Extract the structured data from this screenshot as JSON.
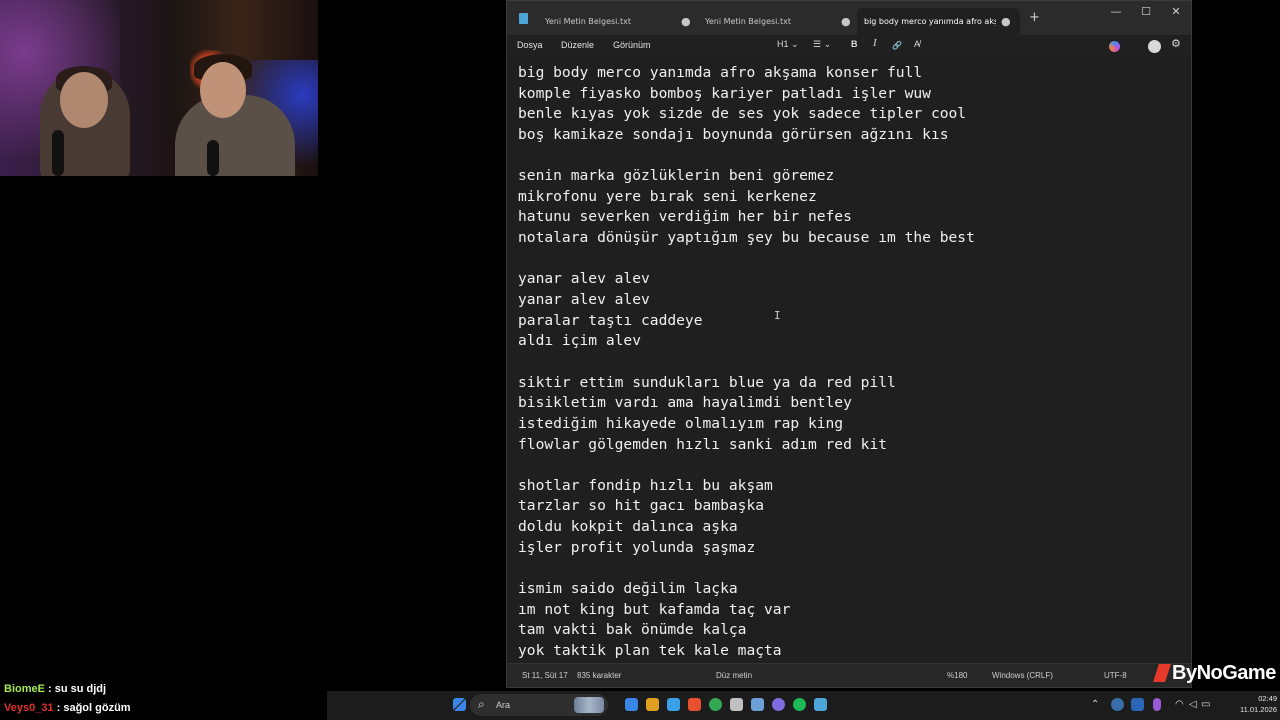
{
  "chat": {
    "messages": [
      {
        "user": "BiomeE",
        "sep": " : ",
        "text": "su su djdj"
      },
      {
        "user": "Veys0_31",
        "sep": " : ",
        "text": "sağol gözüm"
      }
    ]
  },
  "window": {
    "tabs": [
      {
        "label": "Yeni Metin Belgesi.txt",
        "modified": "●"
      },
      {
        "label": "Yeni Metin Belgesi.txt",
        "modified": "●"
      },
      {
        "label": "big body merco yanımda afro akşa",
        "modified": "●"
      }
    ],
    "add_tab": "+",
    "controls": {
      "minimize": "—",
      "maximize": "☐",
      "close": "✕"
    }
  },
  "menubar": {
    "file": "Dosya",
    "edit": "Düzenle",
    "view": "Görünüm",
    "heading": "H1",
    "heading_chevron": "⌄",
    "list": "☰",
    "list_chevron": "⌄",
    "bold": "B",
    "italic": "I",
    "link": "🔗",
    "clear_format": "A̸",
    "settings": "⚙"
  },
  "editor": {
    "lines": [
      "big body merco yanımda afro akşama konser full",
      "komple fiyasko bomboş kariyer patladı işler wuw",
      "benle kıyas yok sizde de ses yok sadece tipler cool",
      "boş kamikaze sondajı boynunda görürsen ağzını kıs",
      "",
      "senin marka gözlüklerin beni göremez",
      "mikrofonu yere bırak seni kerkenez",
      "hatunu severken verdiğim her bir nefes",
      "notalara dönüşür yaptığım şey bu because ım the best",
      "",
      "yanar alev alev",
      "yanar alev alev",
      "paralar taştı caddeye",
      "aldı içim alev",
      "",
      "siktir ettim sundukları blue ya da red pill",
      "bisikletim vardı ama hayalimdi bentley",
      "istediğim hikayede olmalıyım rap king",
      "flowlar gölgemden hızlı sanki adım red kit",
      "",
      "shotlar fondip hızlı bu akşam",
      "tarzlar so hit gacı bambaşka",
      "doldu kokpit dalınca aşka",
      "işler profit yolunda şaşmaz",
      "",
      "ismim saido değilim laçka",
      "ım not king but kafamda taç var",
      "tam vakti bak önümde kalça",
      "yok taktik plan tek kale maçta"
    ],
    "cursor": "I"
  },
  "status": {
    "position": "St 11, Süt 17",
    "chars": "835 karakter",
    "format": "Düz metin",
    "zoom": "%180",
    "line_ending": "Windows (CRLF)",
    "encoding": "UTF-8"
  },
  "brand": "ByNoGame",
  "taskbar": {
    "search_placeholder": "Ara",
    "search_icon": "⌕",
    "tray": {
      "chevron": "⌃",
      "wifi": "◠",
      "volume": "◁",
      "battery": "▭"
    },
    "time": "02:49",
    "date": "11.01.2026",
    "icon_colors": [
      "#3a86e8",
      "#e0a020",
      "#3aa0e8",
      "#e85030",
      "#34a853",
      "#c0c0c0",
      "#6a9fd8",
      "#7e6de0",
      "#1db954",
      "#4ea6d8"
    ]
  }
}
